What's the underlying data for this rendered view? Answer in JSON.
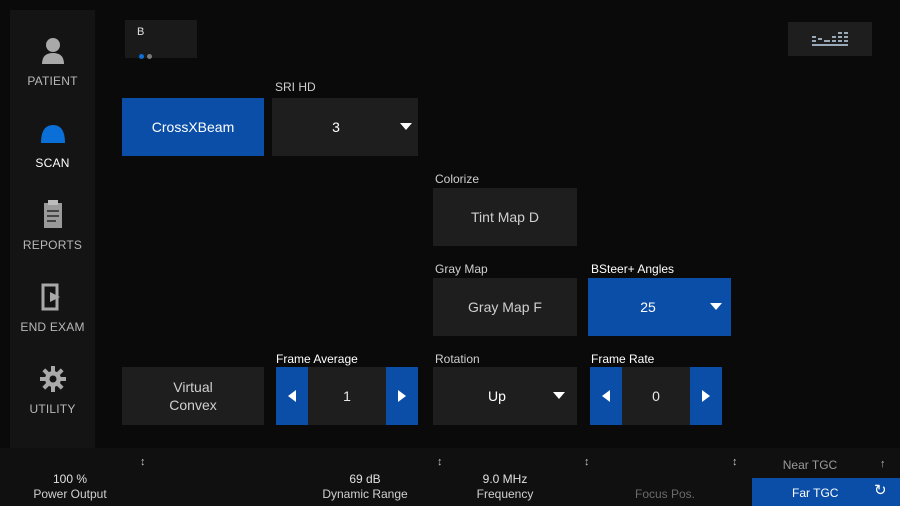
{
  "sidebar": {
    "items": [
      {
        "label": "PATIENT",
        "icon": "person-icon"
      },
      {
        "label": "SCAN",
        "icon": "probe-icon"
      },
      {
        "label": "REPORTS",
        "icon": "reports-icon"
      },
      {
        "label": "END EXAM",
        "icon": "exit-icon"
      },
      {
        "label": "UTILITY",
        "icon": "gear-icon"
      }
    ]
  },
  "tab": {
    "label": "B"
  },
  "controls": {
    "crossxbeam": "CrossXBeam",
    "sri_hd": {
      "label": "SRI HD",
      "value": "3"
    },
    "colorize": {
      "label": "Colorize",
      "value": "Tint Map D"
    },
    "gray_map": {
      "label": "Gray Map",
      "value": "Gray Map F"
    },
    "bsteer": {
      "label": "BSteer+ Angles",
      "value": "25"
    },
    "virtual_convex": "Virtual\nConvex",
    "frame_average": {
      "label": "Frame Average",
      "value": "1"
    },
    "rotation": {
      "label": "Rotation",
      "value": "Up"
    },
    "frame_rate": {
      "label": "Frame Rate",
      "value": "0"
    }
  },
  "bottom": {
    "power_output": {
      "value": "100 %",
      "label": "Power Output"
    },
    "dynamic_range": {
      "value": "69 dB",
      "label": "Dynamic Range"
    },
    "frequency": {
      "value": "9.0 MHz",
      "label": "Frequency"
    },
    "focus_pos": {
      "label": "Focus Pos."
    },
    "near_tgc": {
      "label": "Near TGC"
    },
    "far_tgc": {
      "label": "Far TGC"
    }
  },
  "colors": {
    "accent": "#0a4ea8",
    "background": "#0a0a0a",
    "panel": "#1e1e1e"
  }
}
